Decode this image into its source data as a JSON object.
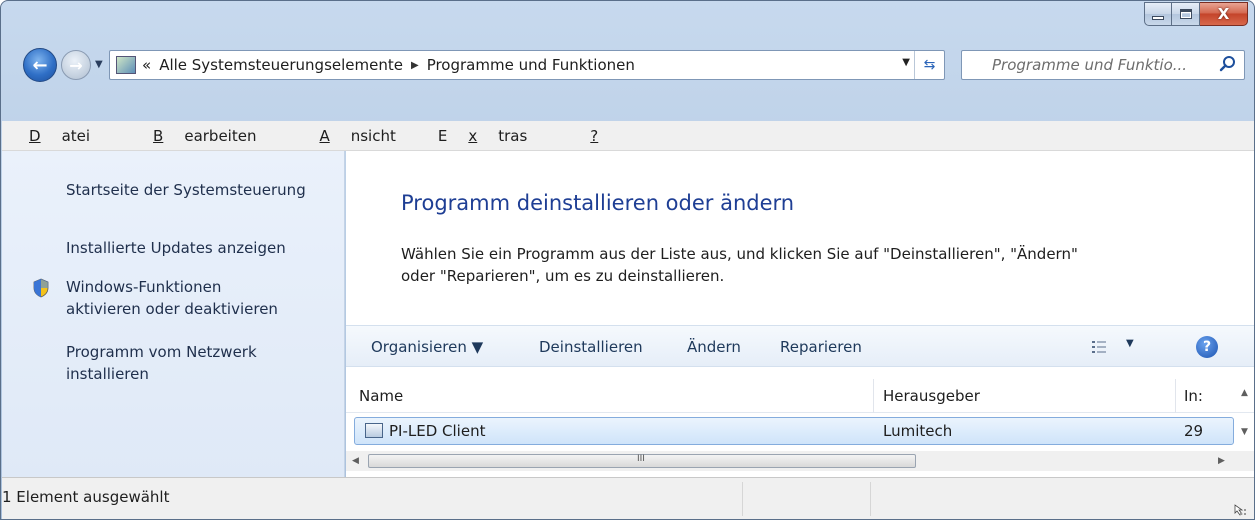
{
  "window": {
    "close_label": "X"
  },
  "nav": {
    "crumb_prefix": "«",
    "crumbs": [
      "Alle Systemsteuerungselemente",
      "Programme und Funktionen"
    ],
    "crumb_separator": "▶",
    "search_placeholder": "Programme und Funktio..."
  },
  "menu": {
    "items": [
      {
        "pre": "",
        "key": "D",
        "post": "atei"
      },
      {
        "pre": "",
        "key": "B",
        "post": "earbeiten"
      },
      {
        "pre": "",
        "key": "A",
        "post": "nsicht"
      },
      {
        "pre": "E",
        "key": "x",
        "post": "tras"
      },
      {
        "pre": "",
        "key": "?",
        "post": ""
      }
    ]
  },
  "sidebar": {
    "link_home": "Startseite der Systemsteuerung",
    "link_updates": "Installierte Updates anzeigen",
    "link_features_1": "Windows-Funktionen",
    "link_features_2": "aktivieren oder deaktivieren",
    "link_network_1": "Programm vom Netzwerk",
    "link_network_2": "installieren"
  },
  "main": {
    "heading": "Programm deinstallieren oder ändern",
    "desc_1": "Wählen Sie ein Programm aus der Liste aus, und klicken Sie auf \"Deinstallieren\", \"Ändern\"",
    "desc_2": "oder \"Reparieren\", um es zu deinstallieren."
  },
  "toolbar": {
    "organize": "Organisieren ▼",
    "uninstall": "Deinstallieren",
    "change": "Ändern",
    "repair": "Reparieren",
    "help": "?"
  },
  "list": {
    "columns": [
      "Name",
      "Herausgeber",
      "In:"
    ],
    "rows": [
      {
        "name": "PI-LED Client",
        "publisher": "Lumitech",
        "installed": "29"
      }
    ],
    "scroll_thumb_glyph": "III"
  },
  "status": {
    "text": "1 Element ausgewählt"
  },
  "colors": {
    "accent": "#1e3e94",
    "link": "#1f2f4c",
    "selection": "#cfe4fa"
  }
}
